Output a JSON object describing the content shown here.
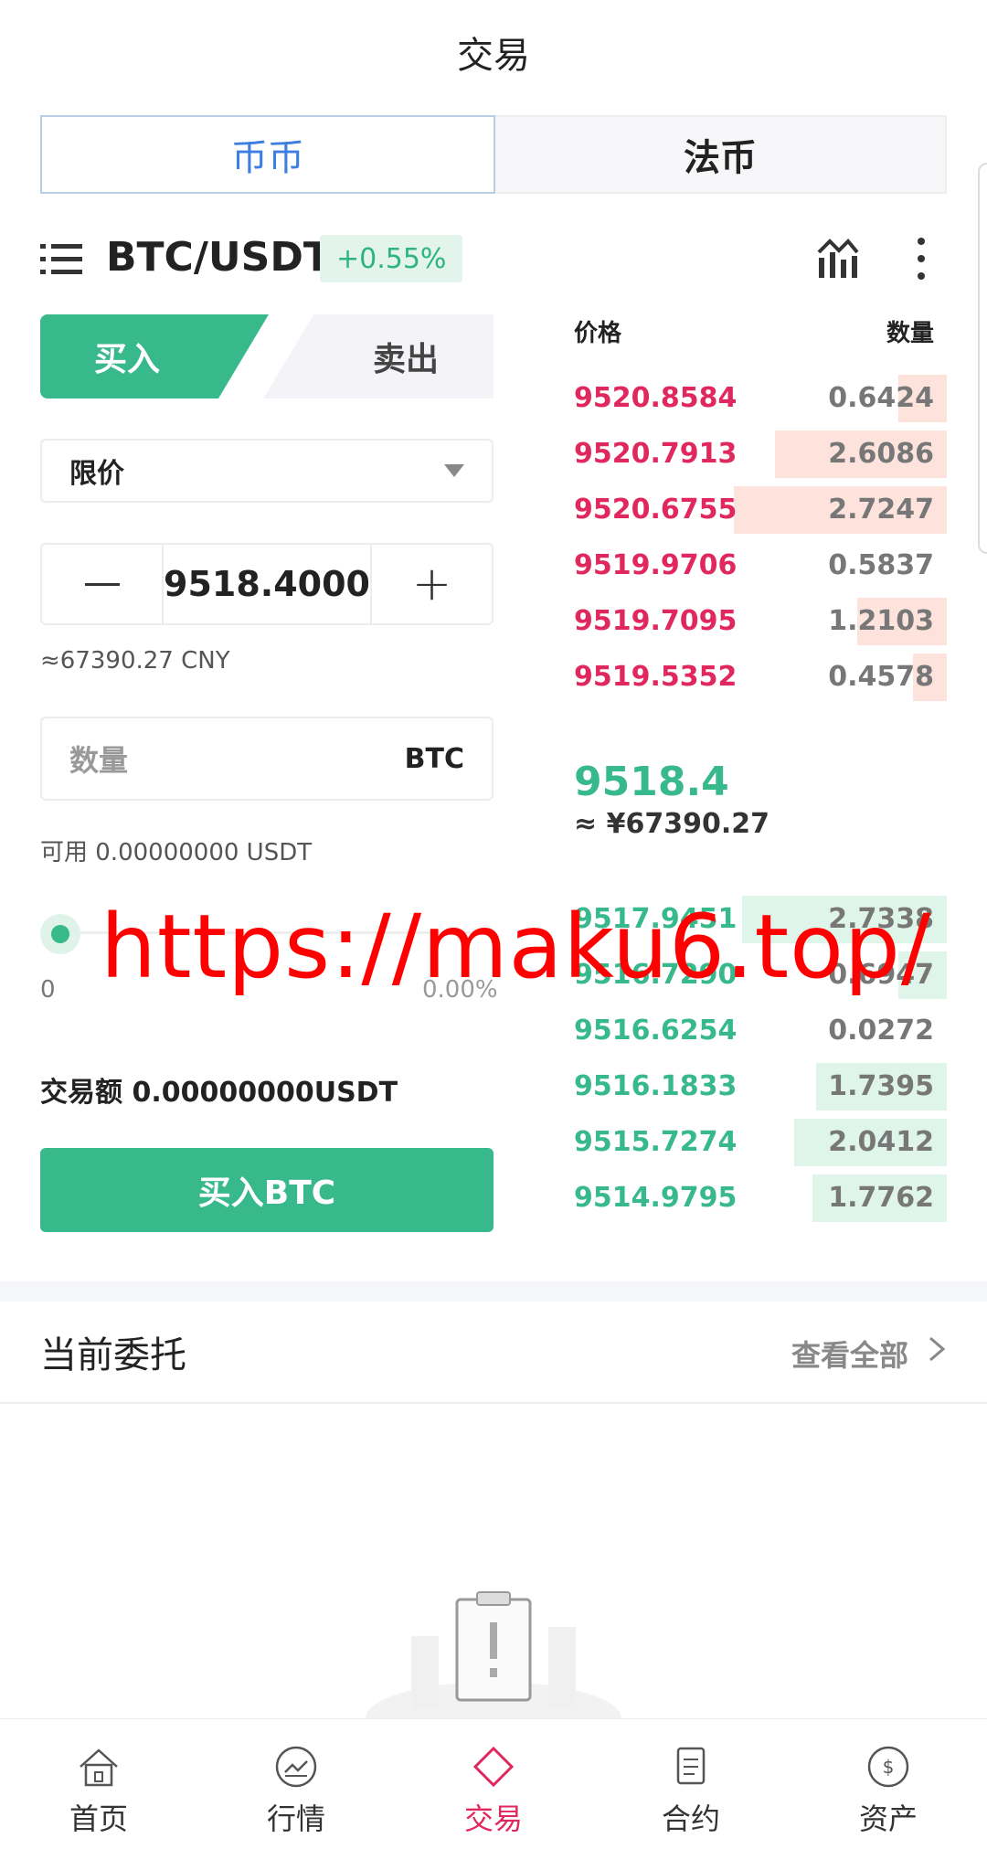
{
  "header": {
    "title": "交易"
  },
  "segment": {
    "tabs": [
      {
        "label": "币币",
        "active": true
      },
      {
        "label": "法币",
        "active": false
      }
    ]
  },
  "pair": {
    "name": "BTC/USDT",
    "change": "+0.55%"
  },
  "trade": {
    "buy_tab": "买入",
    "sell_tab": "卖出",
    "order_type": "限价",
    "price": "9518.4000",
    "price_cny": "≈67390.27 CNY",
    "quantity_placeholder": "数量",
    "quantity_unit": "BTC",
    "available": "可用 0.00000000 USDT",
    "slider_min": "0",
    "slider_value": "0.00%",
    "amount": "交易额 0.00000000USDT",
    "buy_button": "买入BTC"
  },
  "orderbook": {
    "price_header": "价格",
    "qty_header": "数量",
    "asks": [
      {
        "price": "9520.8584",
        "qty": "0.6424",
        "depth": 0.13
      },
      {
        "price": "9520.7913",
        "qty": "2.6086",
        "depth": 0.46
      },
      {
        "price": "9520.6755",
        "qty": "2.7247",
        "depth": 0.57
      },
      {
        "price": "9519.9706",
        "qty": "0.5837",
        "depth": 0.0
      },
      {
        "price": "9519.7095",
        "qty": "1.2103",
        "depth": 0.24
      },
      {
        "price": "9519.5352",
        "qty": "0.4578",
        "depth": 0.09
      }
    ],
    "last_price": "9518.4",
    "last_price_cny": "≈ ¥67390.27",
    "bids": [
      {
        "price": "9517.9451",
        "qty": "2.7338",
        "depth": 0.55
      },
      {
        "price": "9516.7290",
        "qty": "0.6947",
        "depth": 0.13
      },
      {
        "price": "9516.6254",
        "qty": "0.0272",
        "depth": 0.0
      },
      {
        "price": "9516.1833",
        "qty": "1.7395",
        "depth": 0.35
      },
      {
        "price": "9515.7274",
        "qty": "2.0412",
        "depth": 0.41
      },
      {
        "price": "9514.9795",
        "qty": "1.7762",
        "depth": 0.36
      }
    ]
  },
  "watermark": "https://maku6.top/",
  "orders": {
    "title": "当前委托",
    "view_all": "查看全部"
  },
  "tabbar": [
    {
      "label": "首页",
      "icon": "home-icon",
      "active": false
    },
    {
      "label": "行情",
      "icon": "market-icon",
      "active": false
    },
    {
      "label": "交易",
      "icon": "trade-icon",
      "active": true
    },
    {
      "label": "合约",
      "icon": "contract-icon",
      "active": false
    },
    {
      "label": "资产",
      "icon": "assets-icon",
      "active": false
    }
  ],
  "colors": {
    "green": "#38b98c",
    "red": "#e1285e",
    "blue": "#3d7fe0",
    "ask_bg": "#fde3dc",
    "bid_bg": "#dff5e9"
  }
}
